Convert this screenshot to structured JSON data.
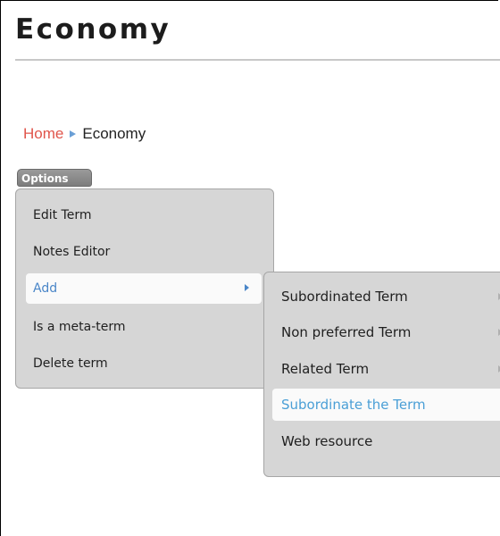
{
  "page": {
    "title": "Economy"
  },
  "breadcrumb": {
    "home": "Home",
    "current": "Economy",
    "separator_icon": "right-triangle-icon"
  },
  "options": {
    "label": "Options"
  },
  "menu": {
    "items": [
      {
        "label": "Edit Term"
      },
      {
        "label": "Notes Editor"
      },
      {
        "label": "Add",
        "active": true,
        "has_submenu": true
      },
      {
        "label": "Is a meta-term"
      },
      {
        "label": "Delete term"
      }
    ]
  },
  "submenu": {
    "items": [
      {
        "label": "Subordinated Term",
        "has_submenu": true
      },
      {
        "label": "Non preferred Term",
        "has_submenu": true
      },
      {
        "label": "Related Term",
        "has_submenu": true
      },
      {
        "label": "Subordinate the Term",
        "highlighted": true
      },
      {
        "label": "Web resource"
      }
    ]
  },
  "colors": {
    "link": "#e0554b",
    "accent": "#4a86c8",
    "menu_bg": "#d6d6d6"
  }
}
